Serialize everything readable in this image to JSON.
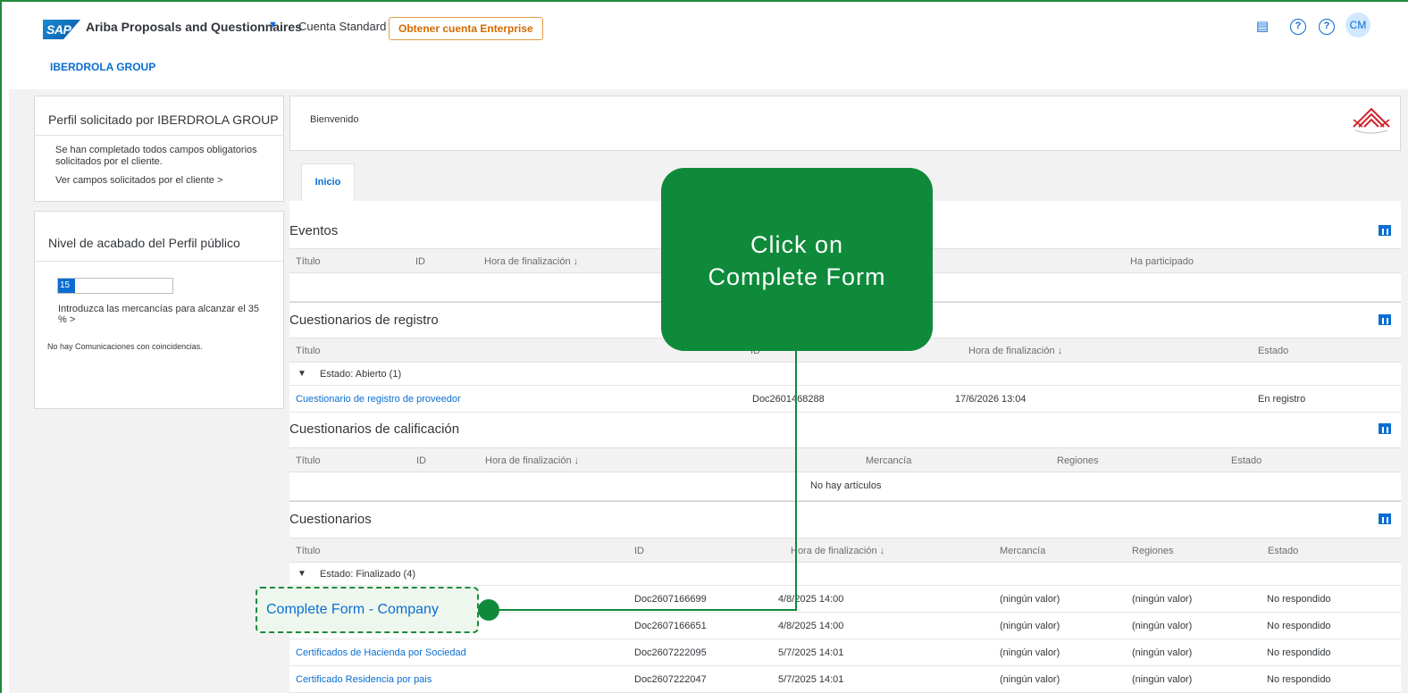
{
  "header": {
    "app_title": "Ariba Proposals and Questionnaires",
    "account_type": "Cuenta Standard",
    "enterprise_button": "Obtener cuenta Enterprise",
    "user_initials": "CM",
    "org_name": "IBERDROLA GROUP",
    "logo_text": "SAP"
  },
  "profile_panel": {
    "title": "Perfil solicitado por IBERDROLA GROUP",
    "message": "Se han completado todos campos obligatorios solicitados por el cliente.",
    "link": "Ver campos solicitados por el cliente >"
  },
  "completion_panel": {
    "title": "Nivel de acabado del Perfil público",
    "progress_label": "15 %",
    "progress_value": 15,
    "hint": "Introduzca las mercancías para alcanzar el 35 % >",
    "no_comms": "No hay Comunicaciones con coincidencias."
  },
  "welcome": "Bienvenido",
  "tabs": [
    {
      "label": "Inicio"
    }
  ],
  "events": {
    "title": "Eventos",
    "columns": [
      "Título",
      "ID",
      "Hora de finalización ↓",
      "Ha participado"
    ]
  },
  "registration": {
    "title": "Cuestionarios de registro",
    "columns": [
      "Título",
      "ID",
      "Hora de finalización ↓",
      "Estado"
    ],
    "group": "Estado: Abierto  (1)",
    "rows": [
      {
        "title": "Cuestionario de registro de proveedor",
        "id": "Doc2601468288",
        "end": "17/6/2026 13:04",
        "status": "En registro"
      }
    ]
  },
  "qualification": {
    "title": "Cuestionarios de calificación",
    "columns": [
      "Título",
      "ID",
      "Hora de finalización ↓",
      "Mercancía",
      "Regiones",
      "Estado"
    ],
    "empty": "No hay artículos"
  },
  "questionnaires": {
    "title": "Cuestionarios",
    "columns": [
      "Título",
      "ID",
      "Hora de finalización ↓",
      "Mercancía",
      "Regiones",
      "Estado"
    ],
    "group": "Estado: Finalizado  (4)",
    "rows": [
      {
        "title": "",
        "id": "Doc2607166699",
        "end": "4/8/2025 14:00",
        "commodity": "(ningún valor)",
        "regions": "(ningún valor)",
        "status": "No respondido"
      },
      {
        "title": "",
        "id": "Doc2607166651",
        "end": "4/8/2025 14:00",
        "commodity": "(ningún valor)",
        "regions": "(ningún valor)",
        "status": "No respondido"
      },
      {
        "title": "Certificados de Hacienda por Sociedad",
        "id": "Doc2607222095",
        "end": "5/7/2025 14:01",
        "commodity": "(ningún valor)",
        "regions": "(ningún valor)",
        "status": "No respondido"
      },
      {
        "title": "Certificado Residencia por pais",
        "id": "Doc2607222047",
        "end": "5/7/2025 14:01",
        "commodity": "(ningún valor)",
        "regions": "(ningún valor)",
        "status": "No respondido"
      }
    ]
  },
  "overlay": {
    "callout_line1": "Click on",
    "callout_line2": "Complete Form",
    "highlight": "Complete Form - Company",
    "color": "#0e8a3a"
  }
}
